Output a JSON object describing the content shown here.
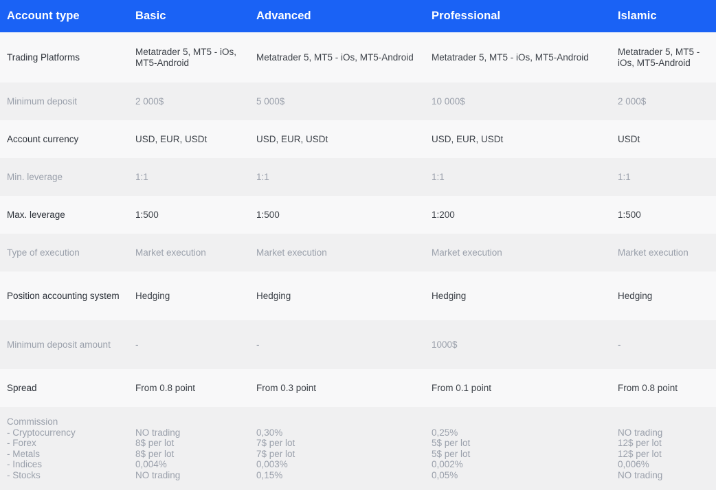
{
  "table": {
    "columns": [
      {
        "key": "feature",
        "label": "Account type"
      },
      {
        "key": "basic",
        "label": "Basic"
      },
      {
        "key": "advanced",
        "label": "Advanced"
      },
      {
        "key": "professional",
        "label": "Professional"
      },
      {
        "key": "islamic",
        "label": "Islamic"
      }
    ],
    "header_bg": "#1a62f5",
    "header_text_color": "#ffffff",
    "row_bg_light": "#f8f8f9",
    "row_bg_dark": "#f0f0f1",
    "rows": [
      {
        "feature": "Trading Platforms",
        "basic": "Metatrader 5, MT5 - iOs, MT5-Android",
        "advanced": "Metatrader 5, MT5 - iOs, MT5-Android",
        "professional": "Metatrader 5, MT5 - iOs, MT5-Android",
        "islamic": "Metatrader 5, MT5 - iOs, MT5-Android"
      },
      {
        "feature": "Minimum deposit",
        "basic": "2 000$",
        "advanced": "5 000$",
        "professional": "10 000$",
        "islamic": "2 000$"
      },
      {
        "feature": "Account currency",
        "basic": "USD, EUR, USDt",
        "advanced": "USD, EUR, USDt",
        "professional": "USD, EUR, USDt",
        "islamic": "USDt"
      },
      {
        "feature": "Min. leverage",
        "basic": "1:1",
        "advanced": "1:1",
        "professional": "1:1",
        "islamic": "1:1"
      },
      {
        "feature": "Max. leverage",
        "basic": "1:500",
        "advanced": "1:500",
        "professional": "1:200",
        "islamic": "1:500"
      },
      {
        "feature": "Type of execution",
        "basic": "Market execution",
        "advanced": "Market execution",
        "professional": "Market execution",
        "islamic": "Market execution"
      },
      {
        "feature": "Position accounting system",
        "basic": "Hedging",
        "advanced": "Hedging",
        "professional": "Hedging",
        "islamic": "Hedging"
      },
      {
        "feature": "Minimum deposit amount",
        "basic": "-",
        "advanced": "-",
        "professional": "1000$",
        "islamic": "-"
      },
      {
        "feature": "Spread",
        "basic": "From 0.8 point",
        "advanced": "From 0.3 point",
        "professional": "From 0.1 point",
        "islamic": "From 0.8 point"
      },
      {
        "feature": "Commission\n- Cryptocurrency\n- Forex\n- Metals\n- Indices\n- Stocks",
        "basic": "\nNO trading\n8$ per lot\n8$ per lot\n0,004%\nNO trading",
        "advanced": "\n0,30%\n7$ per lot\n7$ per lot\n0,003%\n0,15%",
        "professional": "\n0,25%\n5$ per lot\n5$ per lot\n0,002%\n0,05%",
        "islamic": "\nNO trading\n12$ per lot\n12$ per lot\n0,006%\nNO trading"
      }
    ]
  }
}
